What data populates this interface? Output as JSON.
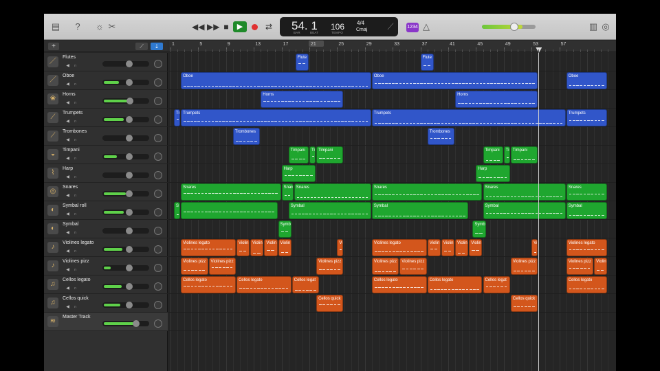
{
  "colors": {
    "blue": "#3156c9",
    "green": "#1fa62f",
    "orange": "#d3561c",
    "play": "#1f8a2a",
    "record": "#e03030",
    "count_in": "#8a36c9"
  },
  "toolbar": {
    "icons": [
      "library-icon",
      "help-icon",
      "smart-controls-icon",
      "editors-icon"
    ],
    "right_icons": [
      "notepad-icon",
      "loops-icon"
    ]
  },
  "lcd": {
    "bar": "54. 1",
    "bar_label": "BAR",
    "beat_label": "BEAT",
    "tempo": "106",
    "tempo_label": "TEMPO",
    "signature": "4/4",
    "key": "Cmaj"
  },
  "count_in": "1234",
  "master_volume": 0.76,
  "header": {
    "add": "+"
  },
  "ruler": {
    "labels": [
      "1",
      "5",
      "9",
      "13",
      "17",
      "21",
      "25",
      "29",
      "33",
      "37",
      "41",
      "45",
      "49",
      "53",
      "57"
    ],
    "playhead_bar": 54
  },
  "tracks": [
    {
      "name": "Flutes",
      "icon": "flute-icon",
      "level": 0
    },
    {
      "name": "Oboe",
      "icon": "oboe-icon",
      "level": 0.35
    },
    {
      "name": "Horns",
      "icon": "horn-icon",
      "level": 0.62
    },
    {
      "name": "Trumpets",
      "icon": "trumpet-icon",
      "level": 0.45
    },
    {
      "name": "Trombones",
      "icon": "trombone-icon",
      "level": 0
    },
    {
      "name": "Timpani",
      "icon": "timpani-icon",
      "level": 0.3
    },
    {
      "name": "Harp",
      "icon": "harp-icon",
      "level": 0
    },
    {
      "name": "Snares",
      "icon": "snare-icon",
      "level": 0.5
    },
    {
      "name": "Symbal roll",
      "icon": "cymbal-icon",
      "level": 0.45
    },
    {
      "name": "Symbal",
      "icon": "cymbal-icon",
      "level": 0
    },
    {
      "name": "Violines legato",
      "icon": "violin-icon",
      "level": 0.42
    },
    {
      "name": "Violines pizz",
      "icon": "violin-icon",
      "level": 0.15
    },
    {
      "name": "Cellos legato",
      "icon": "cello-icon",
      "level": 0.4
    },
    {
      "name": "Cellos quick",
      "icon": "cello-icon",
      "level": 0.38
    },
    {
      "name": "Master Track",
      "icon": "master-icon",
      "level": 0.78,
      "master": true
    }
  ],
  "regions": [
    {
      "lane": 0,
      "start": 18,
      "len": 2,
      "label": "Flute",
      "color": "blue"
    },
    {
      "lane": 0,
      "start": 36,
      "len": 2,
      "label": "Flute",
      "color": "blue"
    },
    {
      "lane": 1,
      "start": 1.5,
      "len": 27.5,
      "label": "Oboe",
      "color": "blue"
    },
    {
      "lane": 1,
      "start": 29,
      "len": 24,
      "label": "Oboe",
      "color": "blue"
    },
    {
      "lane": 1,
      "start": 57,
      "len": 6,
      "label": "Oboe",
      "color": "blue"
    },
    {
      "lane": 2,
      "start": 13,
      "len": 12,
      "label": "Horns",
      "color": "blue"
    },
    {
      "lane": 2,
      "start": 41,
      "len": 12,
      "label": "Horns",
      "color": "blue"
    },
    {
      "lane": 3,
      "start": 0.5,
      "len": 1,
      "label": "Tr",
      "color": "blue"
    },
    {
      "lane": 3,
      "start": 1.5,
      "len": 27.5,
      "label": "Trumpets",
      "color": "blue"
    },
    {
      "lane": 3,
      "start": 29,
      "len": 28,
      "label": "Trumpets",
      "color": "blue"
    },
    {
      "lane": 3,
      "start": 57,
      "len": 6,
      "label": "Trumpets",
      "color": "blue"
    },
    {
      "lane": 4,
      "start": 9,
      "len": 4,
      "label": "Trombones",
      "color": "blue"
    },
    {
      "lane": 4,
      "start": 37,
      "len": 4,
      "label": "Trombones",
      "color": "blue"
    },
    {
      "lane": 5,
      "start": 17,
      "len": 3,
      "label": "Timpani",
      "color": "green"
    },
    {
      "lane": 5,
      "start": 20,
      "len": 1,
      "label": "Ti",
      "color": "green"
    },
    {
      "lane": 5,
      "start": 21,
      "len": 4,
      "label": "Timpani",
      "color": "green"
    },
    {
      "lane": 5,
      "start": 45,
      "len": 3,
      "label": "Timpani",
      "color": "green"
    },
    {
      "lane": 5,
      "start": 48,
      "len": 1,
      "label": "Ti",
      "color": "green"
    },
    {
      "lane": 5,
      "start": 49,
      "len": 4,
      "label": "Timpani",
      "color": "green"
    },
    {
      "lane": 6,
      "start": 16,
      "len": 5,
      "label": "Harp",
      "color": "green"
    },
    {
      "lane": 6,
      "start": 44,
      "len": 5,
      "label": "Harp",
      "color": "green"
    },
    {
      "lane": 7,
      "start": 1.5,
      "len": 14.5,
      "label": "Snares",
      "color": "green"
    },
    {
      "lane": 7,
      "start": 16,
      "len": 1.8,
      "label": "Snare",
      "color": "green"
    },
    {
      "lane": 7,
      "start": 17.8,
      "len": 11.2,
      "label": "Snares",
      "color": "green"
    },
    {
      "lane": 7,
      "start": 29,
      "len": 16,
      "label": "Snares",
      "color": "green"
    },
    {
      "lane": 7,
      "start": 45,
      "len": 12,
      "label": "Snares",
      "color": "green"
    },
    {
      "lane": 7,
      "start": 57,
      "len": 6,
      "label": "Snares",
      "color": "green"
    },
    {
      "lane": 8,
      "start": 0.5,
      "len": 1,
      "label": "S",
      "color": "green"
    },
    {
      "lane": 8,
      "start": 1.5,
      "len": 14,
      "label": "",
      "color": "green"
    },
    {
      "lane": 8,
      "start": 17,
      "len": 12,
      "label": "Symbal",
      "color": "green"
    },
    {
      "lane": 8,
      "start": 29,
      "len": 14,
      "label": "Symbal",
      "color": "green"
    },
    {
      "lane": 8,
      "start": 45,
      "len": 12,
      "label": "Symbal",
      "color": "green"
    },
    {
      "lane": 8,
      "start": 57,
      "len": 6,
      "label": "Symbal",
      "color": "green"
    },
    {
      "lane": 9,
      "start": 15.5,
      "len": 2,
      "label": "Symb",
      "color": "green"
    },
    {
      "lane": 9,
      "start": 43.5,
      "len": 2,
      "label": "Symb",
      "color": "green"
    },
    {
      "lane": 10,
      "start": 1.5,
      "len": 8,
      "label": "Violines legato",
      "color": "orange"
    },
    {
      "lane": 10,
      "start": 9.5,
      "len": 2,
      "label": "Violin",
      "color": "orange"
    },
    {
      "lane": 10,
      "start": 11.5,
      "len": 2,
      "label": "Violin",
      "color": "orange"
    },
    {
      "lane": 10,
      "start": 13.5,
      "len": 2,
      "label": "Violin",
      "color": "orange"
    },
    {
      "lane": 10,
      "start": 15.5,
      "len": 2,
      "label": "Violin",
      "color": "orange"
    },
    {
      "lane": 10,
      "start": 24,
      "len": 1,
      "label": "Vi",
      "color": "orange"
    },
    {
      "lane": 10,
      "start": 29,
      "len": 8,
      "label": "Violines legato",
      "color": "orange"
    },
    {
      "lane": 10,
      "start": 37,
      "len": 2,
      "label": "Violin",
      "color": "orange"
    },
    {
      "lane": 10,
      "start": 39,
      "len": 2,
      "label": "Violin",
      "color": "orange"
    },
    {
      "lane": 10,
      "start": 41,
      "len": 2,
      "label": "Violin",
      "color": "orange"
    },
    {
      "lane": 10,
      "start": 43,
      "len": 2,
      "label": "Violin",
      "color": "orange"
    },
    {
      "lane": 10,
      "start": 52,
      "len": 1,
      "label": "Vi",
      "color": "orange"
    },
    {
      "lane": 10,
      "start": 57,
      "len": 6,
      "label": "Violines legato",
      "color": "orange"
    },
    {
      "lane": 11,
      "start": 1.5,
      "len": 4,
      "label": "Violines pizz",
      "color": "orange"
    },
    {
      "lane": 11,
      "start": 5.5,
      "len": 4,
      "label": "Violines pizz",
      "color": "orange"
    },
    {
      "lane": 11,
      "start": 21,
      "len": 4,
      "label": "Violines pizz",
      "color": "orange"
    },
    {
      "lane": 11,
      "start": 29,
      "len": 4,
      "label": "Violines pizz",
      "color": "orange"
    },
    {
      "lane": 11,
      "start": 33,
      "len": 4,
      "label": "Violines pizz",
      "color": "orange"
    },
    {
      "lane": 11,
      "start": 49,
      "len": 4,
      "label": "Violines pizz",
      "color": "orange"
    },
    {
      "lane": 11,
      "start": 57,
      "len": 4,
      "label": "Violines pizz",
      "color": "orange"
    },
    {
      "lane": 11,
      "start": 61,
      "len": 2,
      "label": "Violin",
      "color": "orange"
    },
    {
      "lane": 12,
      "start": 1.5,
      "len": 8,
      "label": "Cellos legato",
      "color": "orange"
    },
    {
      "lane": 12,
      "start": 9.5,
      "len": 8,
      "label": "Cellos legato",
      "color": "orange"
    },
    {
      "lane": 12,
      "start": 17.5,
      "len": 4,
      "label": "Cellos legat",
      "color": "orange"
    },
    {
      "lane": 12,
      "start": 29,
      "len": 8,
      "label": "Cellos legato",
      "color": "orange"
    },
    {
      "lane": 12,
      "start": 37,
      "len": 8,
      "label": "Cellos legato",
      "color": "orange"
    },
    {
      "lane": 12,
      "start": 45,
      "len": 4,
      "label": "Cellos legat",
      "color": "orange"
    },
    {
      "lane": 12,
      "start": 57,
      "len": 6,
      "label": "Cellos legato",
      "color": "orange"
    },
    {
      "lane": 13,
      "start": 21,
      "len": 4,
      "label": "Cellos quick",
      "color": "orange"
    },
    {
      "lane": 13,
      "start": 49,
      "len": 4,
      "label": "Cellos quick",
      "color": "orange"
    }
  ]
}
